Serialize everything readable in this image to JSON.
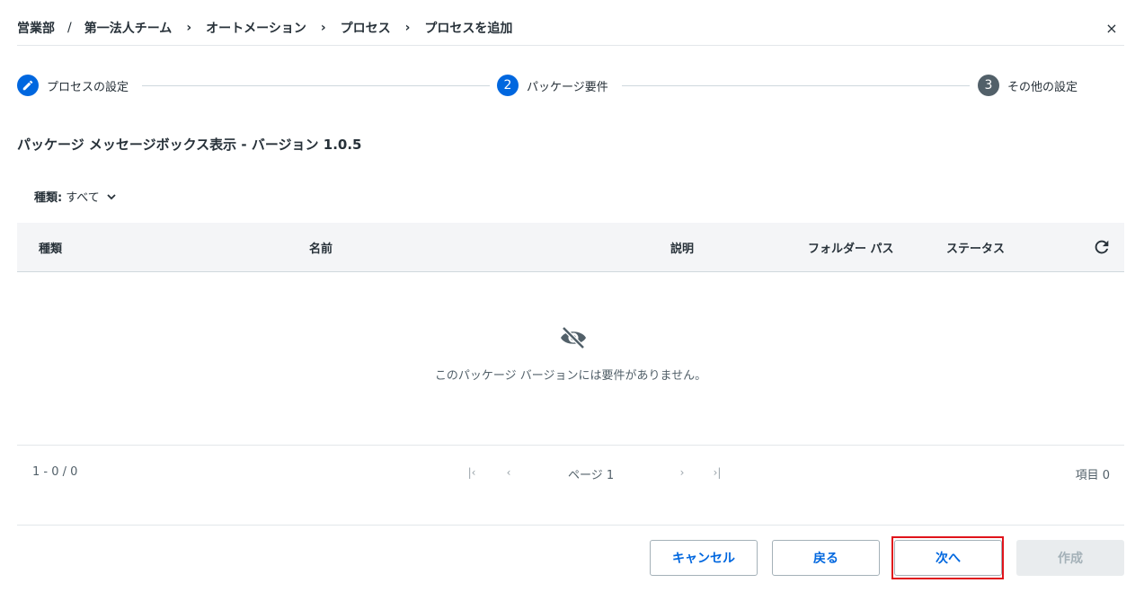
{
  "breadcrumb": {
    "items": [
      "営業部",
      "第一法人チーム",
      "オートメーション",
      "プロセス",
      "プロセスを追加"
    ],
    "separators": [
      "/",
      "›",
      "›",
      "›"
    ]
  },
  "close_icon_glyph": "×",
  "stepper": {
    "steps": [
      {
        "number": "",
        "label": "プロセスの設定",
        "state": "completed"
      },
      {
        "number": "2",
        "label": "パッケージ要件",
        "state": "active"
      },
      {
        "number": "3",
        "label": "その他の設定",
        "state": "pending"
      }
    ]
  },
  "package_title": "パッケージ メッセージボックス表示 - バージョン 1.0.5",
  "filter": {
    "label": "種類:",
    "value": "すべて"
  },
  "table": {
    "columns": [
      "種類",
      "名前",
      "説明",
      "フォルダー パス",
      "ステータス"
    ],
    "rows": [],
    "empty_message": "このパッケージ バージョンには要件がありません。"
  },
  "pagination": {
    "range": "1 - 0 / 0",
    "page_label": "ページ 1",
    "items_label": "項目 0",
    "first_glyph": "|‹",
    "prev_glyph": "‹",
    "next_glyph": "›",
    "last_glyph": "›|"
  },
  "footer": {
    "cancel": "キャンセル",
    "back": "戻る",
    "next": "次へ",
    "create": "作成"
  },
  "colors": {
    "accent": "#0067df",
    "pending_step": "#526069",
    "highlight": "#e0141b",
    "disabled_bg": "#e9ecee"
  }
}
